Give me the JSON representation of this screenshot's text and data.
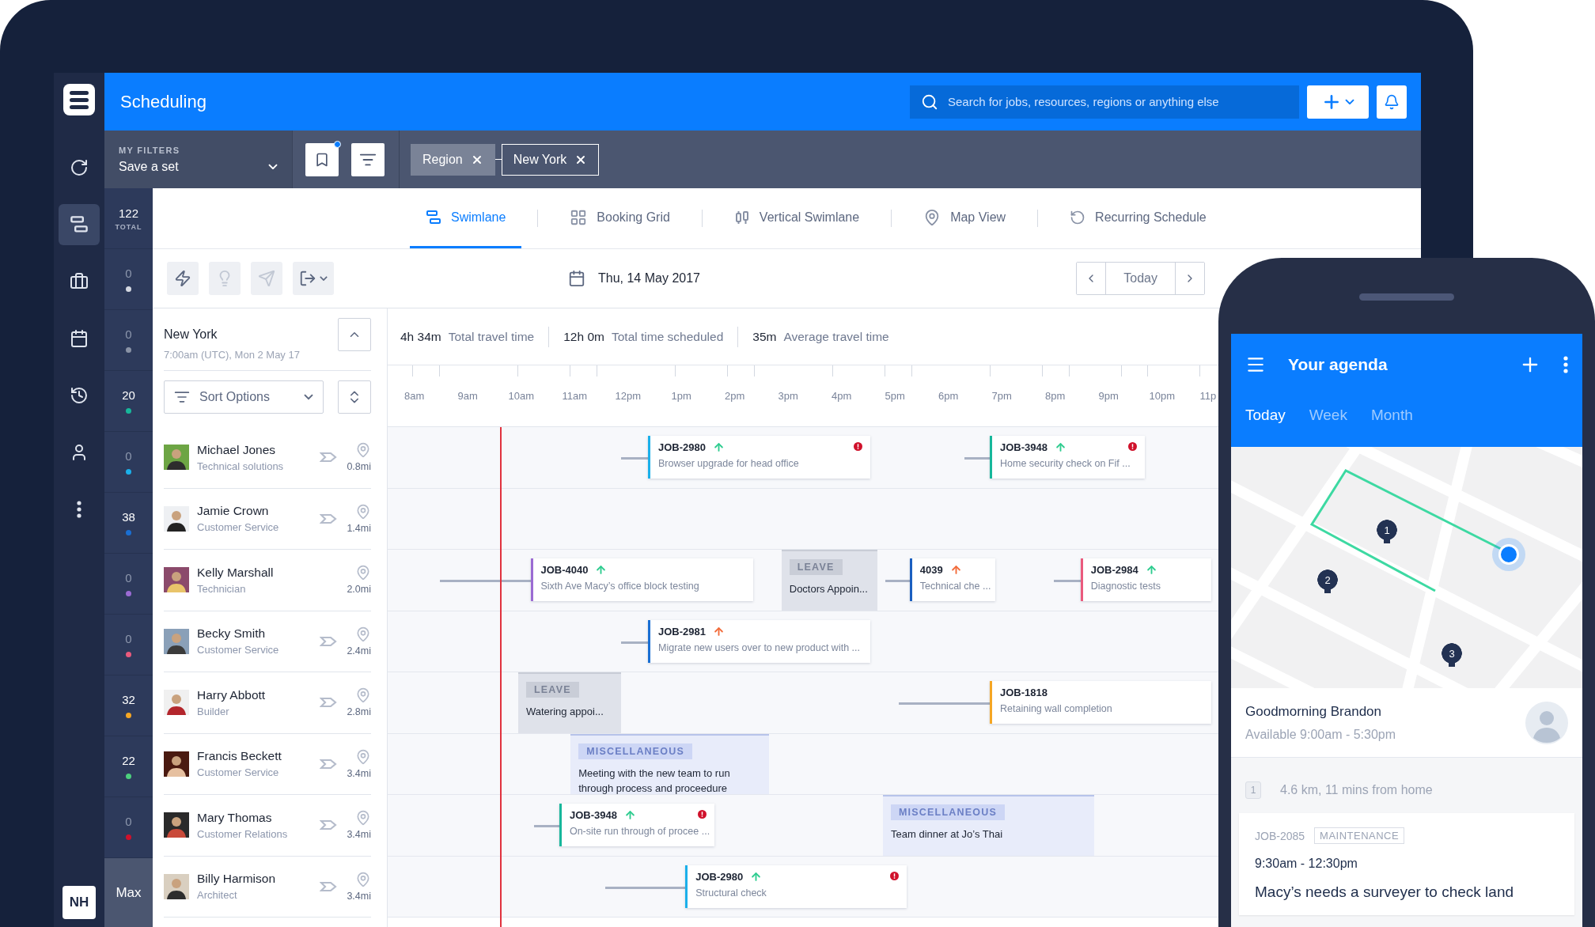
{
  "sidebar": {
    "items": [
      {
        "selected": false
      },
      {
        "selected": true
      },
      {
        "selected": false
      },
      {
        "selected": false
      },
      {
        "selected": false
      },
      {
        "selected": false
      },
      {
        "selected": false
      }
    ],
    "user_initials": "NH"
  },
  "header": {
    "title": "Scheduling",
    "search": {
      "placeholder": "Search for jobs, resources, regions or anything else"
    }
  },
  "filters": {
    "label": "MY FILTERS",
    "set": "Save a set",
    "bookmark_dot": true,
    "chips": [
      {
        "label": "Region",
        "kind": "key"
      },
      {
        "label": "New York",
        "kind": "value"
      }
    ]
  },
  "count_total": {
    "value": "122",
    "caption": "TOTAL"
  },
  "counts": [
    {
      "value": "0",
      "active": false,
      "color": "#d5d9e2"
    },
    {
      "value": "0",
      "active": false,
      "color": "#8a93a6"
    },
    {
      "value": "20",
      "active": true,
      "color": "#17b79b"
    },
    {
      "value": "0",
      "active": false,
      "color": "#1bb0ea"
    },
    {
      "value": "38",
      "active": true,
      "color": "#1a6fd3"
    },
    {
      "value": "0",
      "active": false,
      "color": "#9b6bd3"
    },
    {
      "value": "0",
      "active": false,
      "color": "#ea5a7d"
    },
    {
      "value": "32",
      "active": true,
      "color": "#f5a623"
    },
    {
      "value": "22",
      "active": true,
      "color": "#4cd07d"
    },
    {
      "value": "0",
      "active": false,
      "color": "#d0112b"
    }
  ],
  "count_footer": "Max",
  "views": [
    {
      "label": "Swimlane",
      "selected": true
    },
    {
      "label": "Booking Grid",
      "selected": false
    },
    {
      "label": "Vertical Swimlane",
      "selected": false
    },
    {
      "label": "Map View",
      "selected": false
    },
    {
      "label": "Recurring Schedule",
      "selected": false
    }
  ],
  "toolbar": {
    "actions": [
      {
        "disabled": false
      },
      {
        "disabled": true
      },
      {
        "disabled": true
      },
      {
        "disabled": false
      }
    ],
    "date": "Thu, 14 May 2017",
    "today": "Today"
  },
  "region": {
    "name": "New York",
    "subtitle": "7:00am (UTC), Mon 2 May 17",
    "expanded": true,
    "sort": "Sort Options"
  },
  "stats": [
    {
      "value": "4h 34m",
      "label": "Total travel time"
    },
    {
      "value": "12h 0m",
      "label": "Total time scheduled"
    },
    {
      "value": "35m",
      "label": "Average travel time"
    }
  ],
  "timeline": {
    "hours": [
      "8am",
      "9am",
      "10am",
      "11am",
      "12pm",
      "1pm",
      "2pm",
      "3pm",
      "4pm",
      "5pm",
      "6pm",
      "7pm",
      "8pm",
      "9pm",
      "10pm",
      "11p"
    ]
  },
  "resources": [
    {
      "name": "Michael Jones",
      "role": "Technical solutions",
      "distance": "0.8mi",
      "dispatch": true,
      "bookings": [
        {
          "kind": "job",
          "id": "JOB-2980",
          "arrow": true,
          "urgent": false,
          "alert": true,
          "description": "Browser upgrade for head office",
          "color": "#1bb0ea"
        },
        {
          "kind": "job",
          "id": "JOB-3948",
          "arrow": true,
          "urgent": false,
          "alert": true,
          "description": "Home security check on Fif ...",
          "color": "#17b79b"
        }
      ]
    },
    {
      "name": "Jamie Crown",
      "role": "Customer Service",
      "distance": "1.4mi",
      "dispatch": true
    },
    {
      "name": "Kelly Marshall",
      "role": "Technician",
      "distance": "2.0mi",
      "dispatch": false,
      "bookings": [
        {
          "kind": "job",
          "id": "JOB-4040",
          "arrow": true,
          "urgent": false,
          "alert": false,
          "description": "Sixth Ave Macy’s office block testing",
          "color": "#9b6bd3"
        },
        {
          "kind": "leave",
          "tag": "LEAVE",
          "description": "Doctors Appoin..."
        },
        {
          "kind": "job",
          "id": "4039",
          "arrow": true,
          "urgent": true,
          "alert": false,
          "description": "Technical che ...",
          "color": "#1a5fc0"
        },
        {
          "kind": "job",
          "id": "JOB-2984",
          "arrow": true,
          "urgent": false,
          "alert": false,
          "description": "Diagnostic tests",
          "color": "#ea5a7d"
        }
      ]
    },
    {
      "name": "Becky Smith",
      "role": "Customer Service",
      "distance": "2.4mi",
      "dispatch": true,
      "bookings": [
        {
          "kind": "job",
          "id": "JOB-2981",
          "arrow": true,
          "urgent": true,
          "alert": false,
          "description": "Migrate new users over to new product with ...",
          "color": "#1a6fd3"
        }
      ]
    },
    {
      "name": "Harry Abbott",
      "role": "Builder",
      "distance": "2.8mi",
      "dispatch": true,
      "bookings": [
        {
          "kind": "leave",
          "tag": "LEAVE",
          "description": "Watering appoi..."
        },
        {
          "kind": "job",
          "id": "JOB-1818",
          "arrow": false,
          "alert": false,
          "description": "Retaining wall completion",
          "color": "#f5a623"
        }
      ]
    },
    {
      "name": "Francis Beckett",
      "role": "Customer Service",
      "distance": "3.4mi",
      "dispatch": true,
      "bookings": [
        {
          "kind": "misc",
          "tag": "MISCELLANEOUS",
          "description": "Meeting with the new team to run through process and proceedure"
        }
      ]
    },
    {
      "name": "Mary Thomas",
      "role": "Customer Relations",
      "distance": "3.4mi",
      "dispatch": true,
      "bookings": [
        {
          "kind": "job",
          "id": "JOB-3948",
          "arrow": true,
          "urgent": false,
          "alert": true,
          "description": "On-site run through of procee ...",
          "color": "#17b79b"
        },
        {
          "kind": "misc",
          "tag": "MISCELLANEOUS",
          "description": "Team dinner at Jo’s Thai"
        }
      ]
    },
    {
      "name": "Billy Harmison",
      "role": "Architect",
      "distance": "3.4mi",
      "dispatch": true,
      "bookings": [
        {
          "kind": "job",
          "id": "JOB-2980",
          "arrow": true,
          "urgent": false,
          "alert": true,
          "description": "Structural check",
          "color": "#1bb0ea"
        }
      ]
    }
  ],
  "phone": {
    "title": "Your agenda",
    "tabs": [
      {
        "label": "Today",
        "selected": true
      },
      {
        "label": "Week",
        "selected": false
      },
      {
        "label": "Month",
        "selected": false
      }
    ],
    "map": {
      "pins": [
        "1",
        "2",
        "3"
      ]
    },
    "greeting": "Goodmorning Brandon",
    "availability": "Available 9:00am - 5:30pm",
    "route_step": {
      "number": "1",
      "text": "4.6 km, 11 mins from home"
    },
    "job": {
      "id": "JOB-2085",
      "tag": "MAINTENANCE",
      "time": "9:30am - 12:30pm",
      "title": "Macy’s needs a surveyer to check land"
    }
  }
}
